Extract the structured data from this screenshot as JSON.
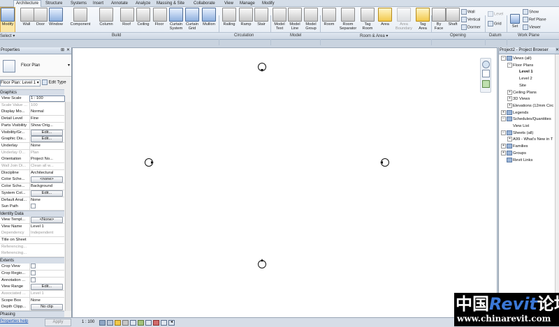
{
  "tabs": [
    "Architecture",
    "Structure",
    "Systems",
    "Insert",
    "Annotate",
    "Analyze",
    "Massing & Site",
    "Collaborate",
    "View",
    "Manage",
    "Modify"
  ],
  "ribbon": {
    "modify": "Modify",
    "select_panel": "Select ▾",
    "build": [
      "Wall",
      "Door",
      "Window",
      "Component",
      "Column",
      "Roof",
      "Ceiling",
      "Floor",
      "Curtain System",
      "Curtain Grid",
      "Mullion"
    ],
    "circulation": [
      "Railing",
      "Ramp",
      "Stair"
    ],
    "model": [
      "Model Text",
      "Model Line",
      "Model Group"
    ],
    "room_area": [
      "Room",
      "Room Separator",
      "Tag Room",
      "Area",
      "Area Boundary",
      "Tag Area"
    ],
    "opening": [
      "By Face",
      "Shaft"
    ],
    "opening_small": [
      "Wall",
      "Vertical",
      "Dormer"
    ],
    "datum": [
      "Level",
      "Grid"
    ],
    "workplane": [
      "Set"
    ],
    "workplane_small": [
      "Show",
      "Ref  Plane",
      "Viewer"
    ],
    "panels": [
      "Build",
      "Circulation",
      "Model",
      "Room & Area ▾",
      "Opening",
      "Datum",
      "Work Plane"
    ]
  },
  "properties": {
    "title": "Properties",
    "type_name": "Floor Plan",
    "selector": "Floor Plan: Level 1 ▾",
    "edit_type": "Edit Type",
    "sections": [
      {
        "name": "Graphics",
        "rows": [
          [
            "View Scale",
            "1 : 100",
            "input"
          ],
          [
            "Scale Value ...",
            "100",
            "dis"
          ],
          [
            "Display Mo...",
            "Normal",
            ""
          ],
          [
            "Detail Level",
            "Fine",
            ""
          ],
          [
            "Parts Visibility",
            "Show Orig...",
            ""
          ],
          [
            "Visibility/Gr...",
            "Edit...",
            "btn"
          ],
          [
            "Graphic Dis...",
            "Edit...",
            "btn"
          ],
          [
            "Underlay",
            "None",
            ""
          ],
          [
            "Underlay O...",
            "Plan",
            "dis"
          ],
          [
            "Orientation",
            "Project No...",
            ""
          ],
          [
            "Wall Join Di...",
            "Clean all w...",
            "dis"
          ],
          [
            "Discipline",
            "Architectural",
            ""
          ],
          [
            "Color Sche...",
            "<none>",
            "btn"
          ],
          [
            "Color Sche...",
            "Background",
            ""
          ],
          [
            "System Col...",
            "Edit...",
            "btn"
          ],
          [
            "Default Anal...",
            "None",
            ""
          ],
          [
            "Sun Path",
            "",
            "chk"
          ]
        ]
      },
      {
        "name": "Identity Data",
        "rows": [
          [
            "View Templ...",
            "<None>",
            "btn"
          ],
          [
            "View Name",
            "Level 1",
            ""
          ],
          [
            "Dependency",
            "Independent",
            "dis"
          ],
          [
            "Title on Sheet",
            "",
            ""
          ],
          [
            "Referencing...",
            "",
            "dis"
          ],
          [
            "Referencing...",
            "",
            "dis"
          ]
        ]
      },
      {
        "name": "Extents",
        "rows": [
          [
            "Crop View",
            "",
            "chk"
          ],
          [
            "Crop Regio...",
            "",
            "chk"
          ],
          [
            "Annotation ...",
            "",
            "chk"
          ],
          [
            "View Range",
            "Edit...",
            "btn"
          ],
          [
            "Associated ...",
            "Level 1",
            "dis"
          ],
          [
            "Scope Box",
            "None",
            ""
          ],
          [
            "Depth Clipp...",
            "No clip",
            "btn"
          ]
        ]
      }
    ],
    "phasing": "Phasing",
    "help": "Properties help",
    "apply": "Apply"
  },
  "browser": {
    "title": "Project2 - Project Browser",
    "nodes": [
      {
        "label": "Views (all)",
        "level": 0,
        "toggle": "−",
        "icon": true
      },
      {
        "label": "Floor Plans",
        "level": 1,
        "toggle": "−"
      },
      {
        "label": "Level 1",
        "level": 2,
        "bold": true
      },
      {
        "label": "Level 2",
        "level": 2
      },
      {
        "label": "Site",
        "level": 2
      },
      {
        "label": "Ceiling Plans",
        "level": 1,
        "toggle": "+"
      },
      {
        "label": "3D Views",
        "level": 1,
        "toggle": "+"
      },
      {
        "label": "Elevations (12mm Circ",
        "level": 1,
        "toggle": "+"
      },
      {
        "label": "Legends",
        "level": 0,
        "toggle": "+",
        "icon": true
      },
      {
        "label": "Schedules/Quantities",
        "level": 0,
        "toggle": "−",
        "icon": true
      },
      {
        "label": "View List",
        "level": 1
      },
      {
        "label": "Sheets (all)",
        "level": 0,
        "toggle": "−",
        "icon": true
      },
      {
        "label": "A99 - What's New in T",
        "level": 1,
        "toggle": "+"
      },
      {
        "label": "Families",
        "level": 0,
        "toggle": "+",
        "icon": true
      },
      {
        "label": "Groups",
        "level": 0,
        "toggle": "+",
        "icon": true
      },
      {
        "label": "Revit Links",
        "level": 0,
        "icon": true
      }
    ]
  },
  "status": {
    "scale": "1 : 100"
  },
  "watermark": {
    "cn_prefix": "中国",
    "brand": "Revit",
    "cn_suffix": "论坛",
    "url": "www.chinarevit.com"
  }
}
